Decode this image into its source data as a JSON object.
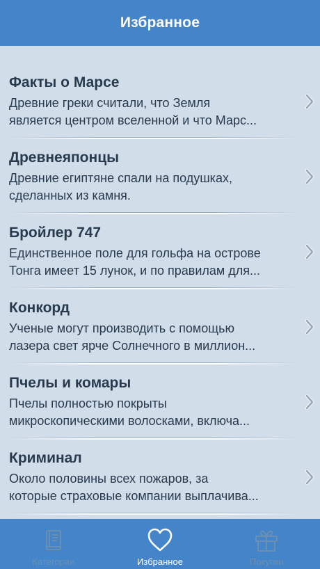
{
  "nav": {
    "title": "Избранное"
  },
  "items": [
    {
      "title": "Факты о Марсе",
      "line1": "Древние греки считали, что Земля",
      "line2": "является центром вселенной и что Марс..."
    },
    {
      "title": "Древнеяпонцы",
      "line1": "Древние египтяне спали на подушках,",
      "line2": "сделанных из камня."
    },
    {
      "title": "Бройлер 747",
      "line1": "Единственное поле для гольфа на острове",
      "line2": "Тонга имеет 15 лунок, и по правилам для..."
    },
    {
      "title": "Конкорд",
      "line1": "Ученые могут производить с помощью",
      "line2": "лазера свет ярче Солнечного в миллион..."
    },
    {
      "title": "Пчелы и комары",
      "line1": "Пчелы полностью покрыты",
      "line2": "микроскопическими волосками, включа..."
    },
    {
      "title": "Криминал",
      "line1": "Около половины всех пожаров, за",
      "line2": "которые страховые компании выплачива..."
    }
  ],
  "icons": {
    "chevron": "chevron-right-icon",
    "categories": "book-icon",
    "favorites": "heart-icon",
    "purchases": "gift-icon"
  },
  "tabs": {
    "categories": "Категории",
    "favorites": "Избранное",
    "purchases": "Покупки"
  },
  "colors": {
    "accent": "#4385c8",
    "background": "#d1dde9",
    "text": "#283a4e",
    "tab_inactive": "#6b8fb3",
    "tab_active": "#ffffff"
  }
}
